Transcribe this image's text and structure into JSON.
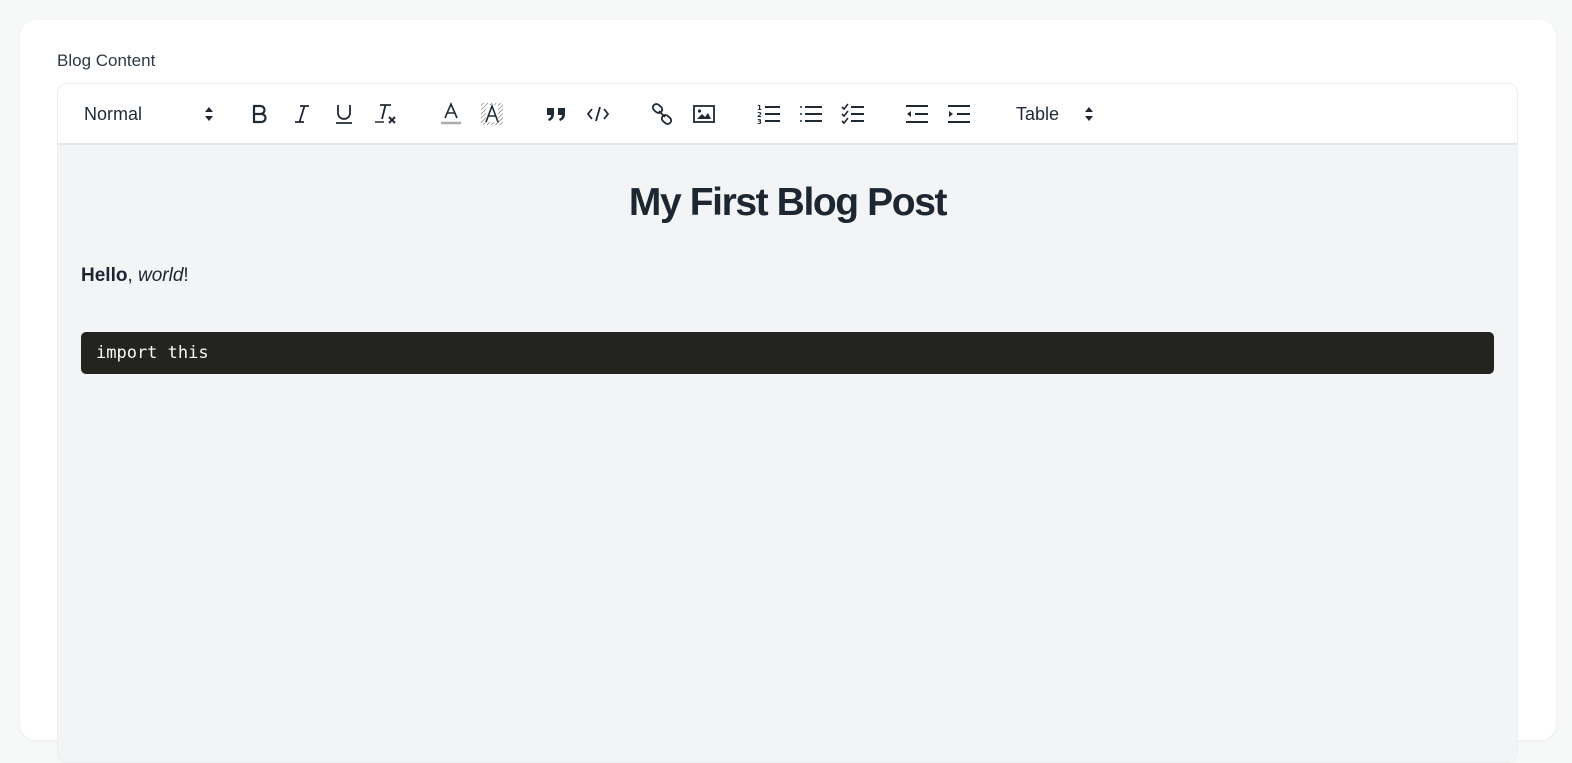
{
  "field": {
    "label": "Blog Content"
  },
  "toolbar": {
    "header_select": {
      "value": "Normal",
      "icon": "select-arrows-icon"
    },
    "buttons": [
      {
        "name": "bold",
        "icon": "bold-icon"
      },
      {
        "name": "italic",
        "icon": "italic-icon"
      },
      {
        "name": "underline",
        "icon": "underline-icon"
      },
      {
        "name": "clean",
        "icon": "clear-formatting-icon"
      },
      {
        "name": "color",
        "icon": "text-color-icon"
      },
      {
        "name": "background",
        "icon": "background-color-icon"
      },
      {
        "name": "blockquote",
        "icon": "quote-icon"
      },
      {
        "name": "code-block",
        "icon": "code-icon"
      },
      {
        "name": "link",
        "icon": "link-icon"
      },
      {
        "name": "image",
        "icon": "image-icon"
      },
      {
        "name": "ordered-list",
        "icon": "ordered-list-icon"
      },
      {
        "name": "bullet-list",
        "icon": "bullet-list-icon"
      },
      {
        "name": "check-list",
        "icon": "check-list-icon"
      },
      {
        "name": "outdent",
        "icon": "outdent-icon"
      },
      {
        "name": "indent",
        "icon": "indent-icon"
      }
    ],
    "table_select": {
      "value": "Table",
      "icon": "select-arrows-icon"
    }
  },
  "document": {
    "title": "My First Blog Post",
    "paragraph": {
      "bold": "Hello",
      "sep": ", ",
      "italic": "world",
      "end": "!"
    },
    "code": "import this"
  },
  "colors": {
    "page_bg": "#f7f8f8",
    "card_bg": "#ffffff",
    "editor_bg": "#f3f4f6",
    "code_bg": "#23241f",
    "code_fg": "#f8f8f2",
    "text": "#1d2731"
  }
}
